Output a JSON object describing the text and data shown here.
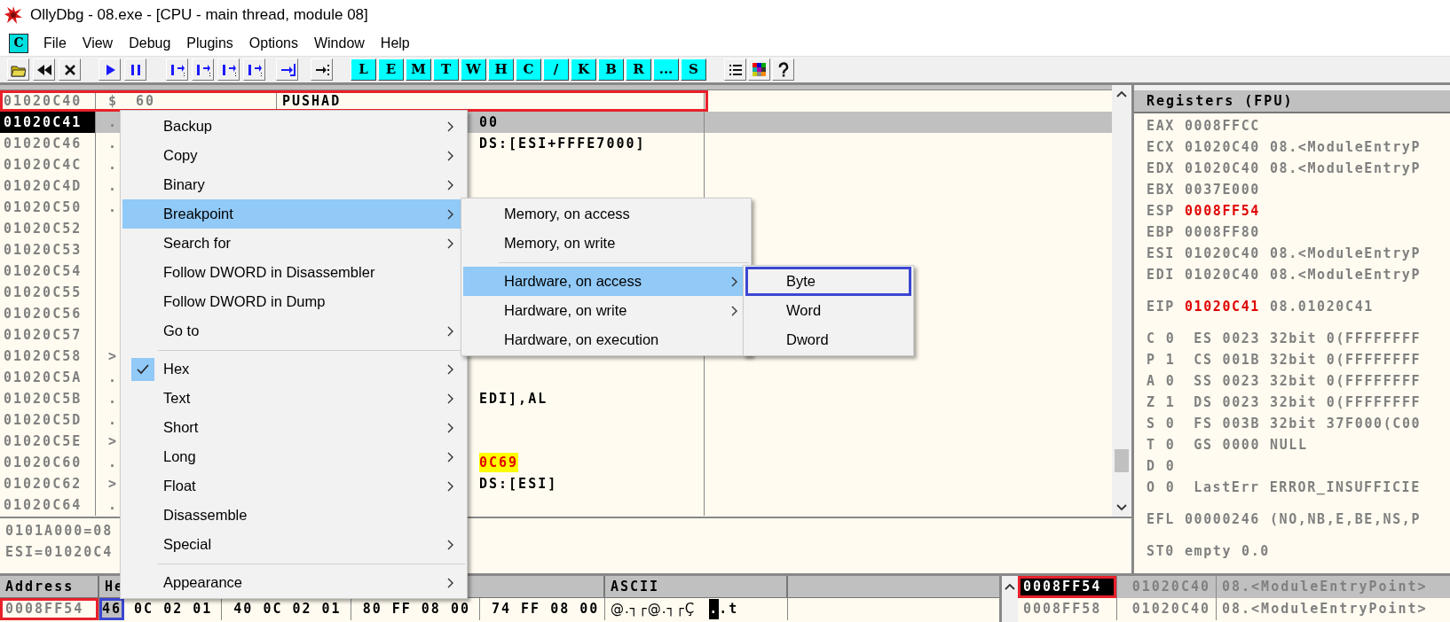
{
  "window": {
    "title": "OllyDbg - 08.exe - [CPU - main thread, module 08]"
  },
  "menu_bar": {
    "app_button": "C",
    "items": [
      "File",
      "View",
      "Debug",
      "Plugins",
      "Options",
      "Window",
      "Help"
    ]
  },
  "toolbar": {
    "letter_buttons": [
      "L",
      "E",
      "M",
      "T",
      "W",
      "H",
      "C",
      "/",
      "K",
      "B",
      "R",
      "...",
      "S"
    ]
  },
  "disassembly": {
    "rows": [
      {
        "address": "01020C40",
        "marker": "$",
        "hex": "60",
        "command": "PUSHAD",
        "selected": false,
        "color": "#e8202a"
      },
      {
        "address": "01020C41",
        "marker": ".",
        "tail": "00",
        "selected": true
      },
      {
        "address": "01020C46",
        "marker": ".",
        "tail": "DS:[ESI+FFFE7000]",
        "selected": false
      },
      {
        "address": "01020C4C",
        "marker": ".",
        "selected": false
      },
      {
        "address": "01020C4D",
        "marker": ".",
        "selected": false
      },
      {
        "address": "01020C50",
        "marker": ".",
        "selected": false
      },
      {
        "address": "01020C52",
        "selected": false
      },
      {
        "address": "01020C53",
        "selected": false
      },
      {
        "address": "01020C54",
        "selected": false
      },
      {
        "address": "01020C55",
        "selected": false
      },
      {
        "address": "01020C56",
        "selected": false
      },
      {
        "address": "01020C57",
        "selected": false
      },
      {
        "address": "01020C58",
        "marker": ">",
        "selected": false
      },
      {
        "address": "01020C5A",
        "marker": ".",
        "selected": false
      },
      {
        "address": "01020C5B",
        "marker": ".",
        "tail": "EDI],AL",
        "selected": false
      },
      {
        "address": "01020C5D",
        "marker": ".",
        "selected": false
      },
      {
        "address": "01020C5E",
        "marker": ">",
        "selected": false
      },
      {
        "address": "01020C60",
        "marker": ".",
        "tail": "0C69",
        "selected": false,
        "highlighted": true
      },
      {
        "address": "01020C62",
        "marker": ">",
        "tail": "DS:[ESI]",
        "selected": false
      },
      {
        "address": "01020C64",
        "marker": ".",
        "selected": false
      }
    ]
  },
  "info_pane": {
    "lines": [
      "0101A000=08",
      "ESI=01020C4"
    ]
  },
  "registers": {
    "title": "Registers (FPU)",
    "groups": [
      [
        {
          "kind": "reg",
          "name": "EAX",
          "value": "0008FFCC",
          "changed": false
        },
        {
          "kind": "reg",
          "name": "ECX",
          "value": "01020C40",
          "comment": "08.<ModuleEntryP",
          "changed": false
        },
        {
          "kind": "reg",
          "name": "EDX",
          "value": "01020C40",
          "comment": "08.<ModuleEntryP",
          "changed": false
        },
        {
          "kind": "reg",
          "name": "EBX",
          "value": "0037E000",
          "changed": false
        },
        {
          "kind": "reg",
          "name": "ESP",
          "value": "0008FF54",
          "changed": true
        },
        {
          "kind": "reg",
          "name": "EBP",
          "value": "0008FF80",
          "changed": false
        },
        {
          "kind": "reg",
          "name": "ESI",
          "value": "01020C40",
          "comment": "08.<ModuleEntryP",
          "changed": false
        },
        {
          "kind": "reg",
          "name": "EDI",
          "value": "01020C40",
          "comment": "08.<ModuleEntryP",
          "changed": false
        }
      ],
      [
        {
          "kind": "reg",
          "name": "EIP",
          "value": "01020C41",
          "comment": "08.01020C41",
          "changed": true
        }
      ],
      [
        {
          "kind": "flag",
          "flag": "C",
          "bit": "0",
          "seg": "ES",
          "value": "0023",
          "info": "32bit 0(FFFFFFFF"
        },
        {
          "kind": "flag",
          "flag": "P",
          "bit": "1",
          "seg": "CS",
          "value": "001B",
          "info": "32bit 0(FFFFFFFF"
        },
        {
          "kind": "flag",
          "flag": "A",
          "bit": "0",
          "seg": "SS",
          "value": "0023",
          "info": "32bit 0(FFFFFFFF"
        },
        {
          "kind": "flag",
          "flag": "Z",
          "bit": "1",
          "seg": "DS",
          "value": "0023",
          "info": "32bit 0(FFFFFFFF"
        },
        {
          "kind": "flag",
          "flag": "S",
          "bit": "0",
          "seg": "FS",
          "value": "003B",
          "info": "32bit 37F000(C00"
        },
        {
          "kind": "flag",
          "flag": "T",
          "bit": "0",
          "seg": "GS",
          "value": "0000",
          "info": "NULL"
        },
        {
          "kind": "flag",
          "flag": "D",
          "bit": "0"
        },
        {
          "kind": "flag",
          "flag": "O",
          "bit": "0",
          "seg": "LastErr",
          "info": "ERROR_INSUFFICIE"
        }
      ],
      [
        {
          "kind": "reg",
          "name": "EFL",
          "value": "00000246",
          "comment": "(NO,NB,E,BE,NS,P",
          "changed": false
        }
      ],
      [
        {
          "kind": "reg",
          "name": "ST0",
          "value": "empty",
          "comment": "0.0",
          "changed": false
        }
      ]
    ]
  },
  "dump": {
    "columns": [
      "Address",
      "He",
      "ASCII"
    ],
    "rows": [
      {
        "address": "0008FF54",
        "color": "#e8202a",
        "bytes": [
          {
            "text": "46",
            "color": "#3c46d2"
          },
          {
            "text": "0C 02 01"
          },
          {
            "text": "40 0C 02 01"
          },
          {
            "text": "80 FF 08 00"
          },
          {
            "text": "74 FF 08 00"
          }
        ],
        "ascii": "@.┐┌@.┐┌Ç",
        "ascii_mark": ".",
        "ascii_tail": ".t"
      }
    ]
  },
  "stack": {
    "rows": [
      {
        "address": "0008FF54",
        "value": "01020C40",
        "comment": "08.<ModuleEntryPoint>",
        "selected": true,
        "color": "#e8202a"
      },
      {
        "address": "0008FF58",
        "value": "01020C40",
        "comment": "08.<ModuleEntryPoint>",
        "selected": false
      }
    ]
  },
  "context_menu": {
    "items": [
      {
        "kind": "item",
        "label": "Backup",
        "submenu": true,
        "selected": false,
        "checked": false
      },
      {
        "kind": "item",
        "label": "Copy",
        "submenu": true,
        "selected": false,
        "checked": false
      },
      {
        "kind": "item",
        "label": "Binary",
        "submenu": true,
        "selected": false,
        "checked": false
      },
      {
        "kind": "item",
        "label": "Breakpoint",
        "submenu": true,
        "selected": true,
        "checked": false
      },
      {
        "kind": "item",
        "label": "Search for",
        "submenu": true,
        "selected": false,
        "checked": false
      },
      {
        "kind": "item",
        "label": "Follow DWORD in Disassembler",
        "submenu": false,
        "selected": false,
        "checked": false
      },
      {
        "kind": "item",
        "label": "Follow DWORD in Dump",
        "submenu": false,
        "selected": false,
        "checked": false
      },
      {
        "kind": "item",
        "label": "Go to",
        "submenu": true,
        "selected": false,
        "checked": false
      },
      {
        "kind": "separator"
      },
      {
        "kind": "item",
        "label": "Hex",
        "submenu": true,
        "selected": false,
        "checked": true
      },
      {
        "kind": "item",
        "label": "Text",
        "submenu": true,
        "selected": false,
        "checked": false
      },
      {
        "kind": "item",
        "label": "Short",
        "submenu": true,
        "selected": false,
        "checked": false
      },
      {
        "kind": "item",
        "label": "Long",
        "submenu": true,
        "selected": false,
        "checked": false
      },
      {
        "kind": "item",
        "label": "Float",
        "submenu": true,
        "selected": false,
        "checked": false
      },
      {
        "kind": "item",
        "label": "Disassemble",
        "submenu": false,
        "selected": false,
        "checked": false
      },
      {
        "kind": "item",
        "label": "Special",
        "submenu": true,
        "selected": false,
        "checked": false
      },
      {
        "kind": "separator"
      },
      {
        "kind": "item",
        "label": "Appearance",
        "submenu": true,
        "selected": false,
        "checked": false
      }
    ]
  },
  "breakpoint_submenu": {
    "items": [
      {
        "kind": "item",
        "label": "Memory, on access",
        "submenu": false,
        "selected": false
      },
      {
        "kind": "item",
        "label": "Memory, on write",
        "submenu": false,
        "selected": false
      },
      {
        "kind": "separator"
      },
      {
        "kind": "item",
        "label": "Hardware, on access",
        "submenu": true,
        "selected": true
      },
      {
        "kind": "item",
        "label": "Hardware, on write",
        "submenu": true,
        "selected": false
      },
      {
        "kind": "item",
        "label": "Hardware, on execution",
        "submenu": false,
        "selected": false
      }
    ]
  },
  "hardware_submenu": {
    "items": [
      {
        "kind": "item",
        "label": "Byte",
        "selected": false,
        "color": "#3c46d2"
      },
      {
        "kind": "item",
        "label": "Word",
        "selected": false
      },
      {
        "kind": "item",
        "label": "Dword",
        "selected": false
      }
    ]
  }
}
